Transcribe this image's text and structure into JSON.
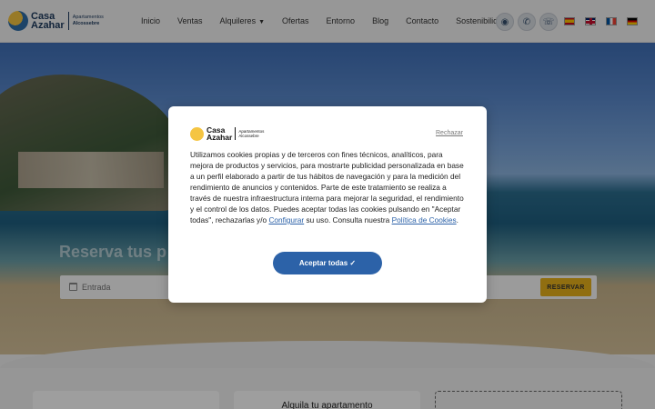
{
  "brand": {
    "name_line1": "Casa",
    "name_line2": "Azahar",
    "sub_line1": "Apartamentos",
    "sub_line2": "Alcossebre"
  },
  "nav": {
    "items": [
      "Inicio",
      "Ventas",
      "Alquileres",
      "Ofertas",
      "Entorno",
      "Blog",
      "Contacto",
      "Sostenibilidad"
    ]
  },
  "header_icons": [
    "map-pin-icon",
    "whatsapp-icon",
    "phone-icon"
  ],
  "languages": [
    "es",
    "en",
    "fr",
    "de"
  ],
  "hero": {
    "title": "Reserva tus p",
    "search_placeholder": "Entrada",
    "reserve_label": "RESERVAR"
  },
  "cards": {
    "middle_title": "Alquila tu apartamento"
  },
  "cookie_modal": {
    "reject_label": "Rechazar",
    "text_main": "Utilizamos cookies propias y de terceros con fines técnicos, analíticos, para mejora de productos y servicios, para mostrarte publicidad personalizada en base a un perfil elaborado a partir de tus hábitos de navegación y para la medición del rendimiento de anuncios y contenidos. Parte de este tratamiento se realiza a través de nuestra infraestructura interna para mejorar la seguridad, el rendimiento y el control de los datos. Puedes aceptar todas las cookies pulsando en \"Aceptar todas\", rechazarlas y/o",
    "configure_link": "Configurar",
    "text_mid": " su uso. Consulta nuestra ",
    "policy_link": "Política de Cookies",
    "text_end": ".",
    "accept_label": "Aceptar todas ✓"
  },
  "colors": {
    "primary_blue": "#2c62a8",
    "reserve_yellow": "#e8b21b",
    "brand_navy": "#1d3a5e"
  }
}
